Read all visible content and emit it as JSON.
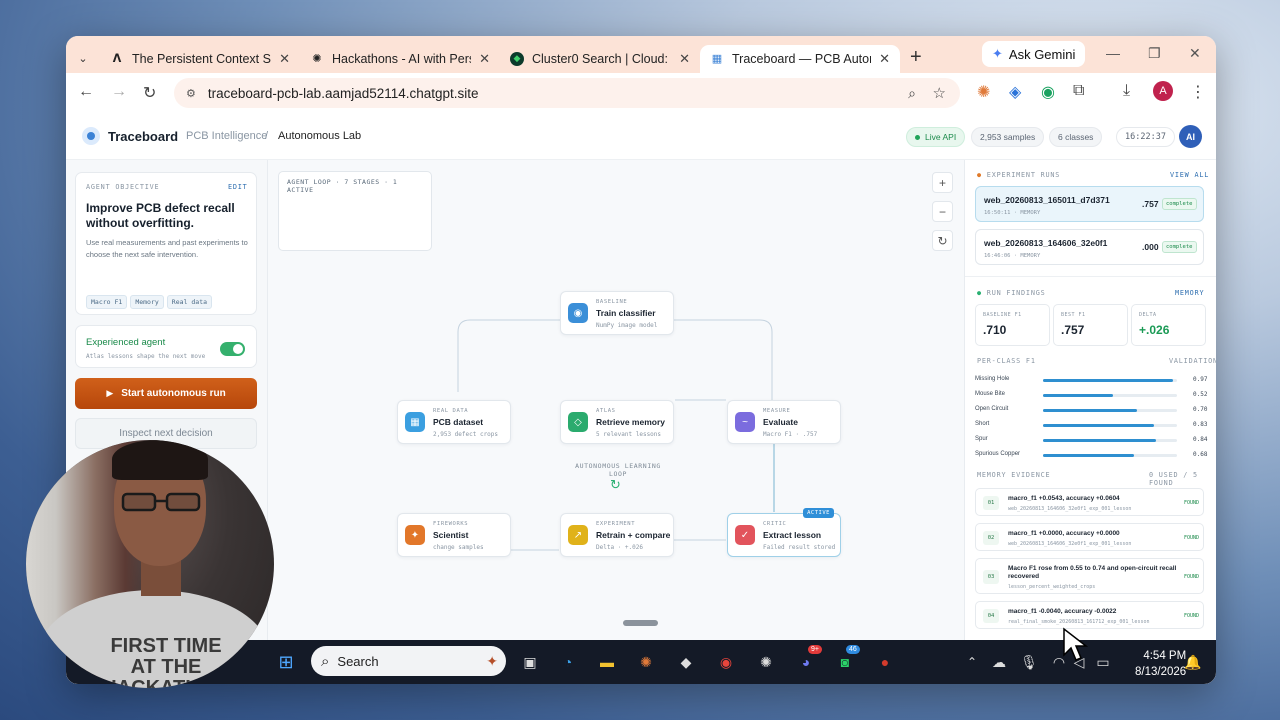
{
  "browser": {
    "tabs": [
      {
        "title": "The Persistent Context Sprint",
        "icon": "tab-icon-a",
        "active": false
      },
      {
        "title": "Hackathons - AI with Persiste",
        "icon": "openai-icon",
        "active": false
      },
      {
        "title": "Cluster0 Search | Cloud: Mon",
        "icon": "mongodb-leaf-icon",
        "active": false
      },
      {
        "title": "Traceboard — PCB Autonomou",
        "icon": "traceboard-icon",
        "active": true
      }
    ],
    "gemini_label": "Ask Gemini",
    "url": "traceboard-pcb-lab.aamjad52114.chatgpt.site",
    "profile_initial": "A"
  },
  "header": {
    "brand": "Traceboard",
    "crumb_parent": "PCB Intelligence",
    "crumb_sep": "/",
    "crumb_current": "Autonomous Lab",
    "live": "Live API",
    "samples": "2,953 samples",
    "classes": "6 classes",
    "time": "16:22:37",
    "avatar": "AI"
  },
  "objective": {
    "label": "AGENT OBJECTIVE",
    "edit": "EDIT",
    "title": "Improve PCB defect recall without overfitting.",
    "desc": "Use real measurements and past experiments to choose the next safe intervention.",
    "chips": [
      "Macro F1",
      "Memory",
      "Real data"
    ]
  },
  "agent": {
    "title": "Experienced agent",
    "sub": "Atlas lessons shape the next move",
    "enabled": true
  },
  "buttons": {
    "start": "Start autonomous run",
    "inspect": "Inspect next decision"
  },
  "canvas": {
    "loop_label": "AGENT LOOP · 7 STAGES · 1 ACTIVE",
    "center_label": "AUTONOMOUS LEARNING LOOP",
    "nodes": [
      {
        "kicker": "BASELINE",
        "title": "Train classifier",
        "sub": "NumPy image model",
        "color": "#3b8fd8",
        "glyph": "◉"
      },
      {
        "kicker": "REAL DATA",
        "title": "PCB dataset",
        "sub": "2,953 defect crops",
        "color": "#3b9fe0",
        "glyph": "▦"
      },
      {
        "kicker": "ATLAS",
        "title": "Retrieve memory",
        "sub": "5 relevant lessons",
        "color": "#2bab6e",
        "glyph": "◇"
      },
      {
        "kicker": "MEASURE",
        "title": "Evaluate",
        "sub": "Macro F1 · .757",
        "color": "#7b6cde",
        "glyph": "~"
      },
      {
        "kicker": "FIREWORKS",
        "title": "Scientist",
        "sub": "change samples",
        "color": "#e2772a",
        "glyph": "✦"
      },
      {
        "kicker": "EXPERIMENT",
        "title": "Retrain + compare",
        "sub": "Delta · +.026",
        "color": "#e0b21a",
        "glyph": "↗"
      },
      {
        "kicker": "CRITIC",
        "title": "Extract lesson",
        "sub": "Failed result stored",
        "color": "#e2545c",
        "glyph": "✓",
        "badge": "ACTIVE"
      }
    ]
  },
  "runs": {
    "label": "EXPERIMENT RUNS",
    "view_all": "VIEW ALL",
    "items": [
      {
        "name": "web_20260813_165011_d7d371",
        "meta": "16:50:11 · MEMORY",
        "value": ".757",
        "status": "complete"
      },
      {
        "name": "web_20260813_164606_32e0f1",
        "meta": "16:46:06 · MEMORY",
        "value": ".000",
        "status": "complete"
      }
    ]
  },
  "findings": {
    "label": "RUN FINDINGS",
    "tag": "MEMORY",
    "metrics": [
      {
        "label": "BASELINE F1",
        "value": ".710"
      },
      {
        "label": "BEST F1",
        "value": ".757"
      },
      {
        "label": "DELTA",
        "value": "+.026"
      }
    ],
    "perclass_label": "PER-CLASS F1",
    "perclass_tag": "VALIDATION",
    "classes": [
      {
        "name": "Missing Hole",
        "value": 0.97,
        "text": "0.97"
      },
      {
        "name": "Mouse Bite",
        "value": 0.52,
        "text": "0.52"
      },
      {
        "name": "Open Circuit",
        "value": 0.7,
        "text": "0.70"
      },
      {
        "name": "Short",
        "value": 0.83,
        "text": "0.83"
      },
      {
        "name": "Spur",
        "value": 0.84,
        "text": "0.84"
      },
      {
        "name": "Spurious Copper",
        "value": 0.68,
        "text": "0.68"
      }
    ]
  },
  "evidence": {
    "label": "MEMORY EVIDENCE",
    "count": "0 USED / 5 FOUND",
    "items": [
      {
        "no": "01",
        "title": "macro_f1 +0.0543, accuracy +0.0604",
        "sub": "web_20260813_164606_32e0f1_exp_001_lesson",
        "state": "FOUND"
      },
      {
        "no": "02",
        "title": "macro_f1 +0.0000, accuracy +0.0000",
        "sub": "web_20260813_164606_32e0f1_exp_001_lesson",
        "state": "FOUND"
      },
      {
        "no": "03",
        "title": "Macro F1 rose from 0.55 to 0.74 and open-circuit recall recovered",
        "sub": "lesson_percent_weighted_crops",
        "state": "FOUND"
      },
      {
        "no": "04",
        "title": "macro_f1 -0.0040, accuracy -0.0022",
        "sub": "real_final_smoke_20260813_161712_exp_001_lesson",
        "state": "FOUND"
      }
    ]
  },
  "taskbar": {
    "search": "Search",
    "time": "4:54 PM",
    "date": "8/13/2026",
    "badge_discord": "9+",
    "badge_whatsapp": "46"
  },
  "webcam": {
    "shirt_text": "FIRST TIME AT THE HACKATHON"
  }
}
